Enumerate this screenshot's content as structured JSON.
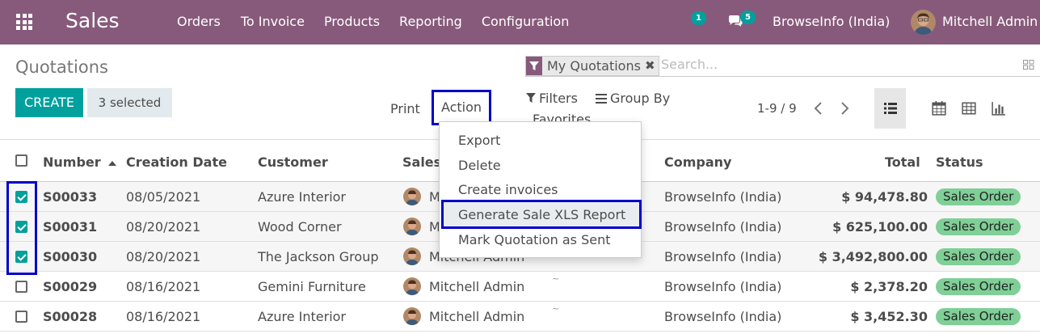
{
  "navbar": {
    "app_name": "Sales",
    "menu": [
      "Orders",
      "To Invoice",
      "Products",
      "Reporting",
      "Configuration"
    ],
    "activity_count": "1",
    "message_count": "5",
    "company": "BrowseInfo (India)",
    "user": "Mitchell Admin",
    "bg_color": "#875a7b"
  },
  "control_panel": {
    "breadcrumb": "Quotations",
    "create_label": "CREATE",
    "selected_label": "3 selected",
    "print_label": "Print",
    "action_label": "Action",
    "search_facet": "My Quotations",
    "search_placeholder": "Search...",
    "filters_label": "Filters",
    "groupby_label": "Group By",
    "favorites_label": "Favorites",
    "pager": "1-9 / 9"
  },
  "action_menu": {
    "items": [
      "Export",
      "Delete",
      "Create invoices",
      "Generate Sale XLS Report",
      "Mark Quotation as Sent"
    ],
    "highlighted": "Generate Sale XLS Report"
  },
  "table": {
    "headers": {
      "number": "Number",
      "creation_date": "Creation Date",
      "customer": "Customer",
      "salesperson": "Sales",
      "company": "Company",
      "total": "Total",
      "status": "Status"
    },
    "rows": [
      {
        "checked": true,
        "number": "S00033",
        "date": "08/05/2021",
        "customer": "Azure Interior",
        "salesperson": "M",
        "company": "BrowseInfo (India)",
        "total": "$ 94,478.80",
        "status": "Sales Order"
      },
      {
        "checked": true,
        "number": "S00031",
        "date": "08/20/2021",
        "customer": "Wood Corner",
        "salesperson": "M",
        "company": "BrowseInfo (India)",
        "total": "$ 625,100.00",
        "status": "Sales Order"
      },
      {
        "checked": true,
        "number": "S00030",
        "date": "08/20/2021",
        "customer": "The Jackson Group",
        "salesperson": "Mitchell Admin",
        "company": "BrowseInfo (India)",
        "total": "$ 3,492,800.00",
        "status": "Sales Order"
      },
      {
        "checked": false,
        "number": "S00029",
        "date": "08/16/2021",
        "customer": "Gemini Furniture",
        "salesperson": "Mitchell Admin",
        "company": "BrowseInfo (India)",
        "total": "$ 2,378.20",
        "status": "Sales Order"
      },
      {
        "checked": false,
        "number": "S00028",
        "date": "08/16/2021",
        "customer": "Azure Interior",
        "salesperson": "Mitchell Admin",
        "company": "BrowseInfo (India)",
        "total": "$ 3,452.30",
        "status": "Sales Order"
      }
    ]
  },
  "colors": {
    "primary": "#00a09d",
    "brand": "#875a7b",
    "status_badge": "#7fcf97",
    "annotation": "#0000c8"
  }
}
